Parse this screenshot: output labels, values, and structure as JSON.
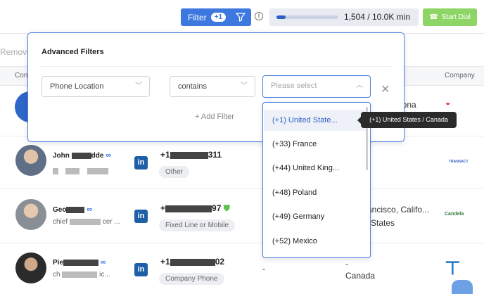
{
  "topbar": {
    "filter_label": "Filter",
    "filter_count": "+1",
    "usage_text": "1,504 / 10.0K min",
    "usage_fraction": 0.15,
    "start_dial_label": "Start Dial"
  },
  "table": {
    "remove_label": "Remove",
    "header_contact": "Con",
    "header_company": "Company",
    "rows": [
      {
        "name": "John",
        "name_suffix": "dde",
        "phone_prefix": "+1",
        "phone_suffix": "311",
        "tag": "Other"
      },
      {
        "name": "Geo",
        "title": "chief",
        "title_mid": "cer ...",
        "phone_prefix": "+",
        "phone_suffix": "97",
        "tag": "Fixed Line or Mobile",
        "location": "ancisco, Califo...",
        "location2": "States"
      },
      {
        "name": "Pie",
        "title": "ch",
        "title_mid": "ic...",
        "phone_prefix": "+1",
        "phone_suffix": "02",
        "tag": "Company Phone",
        "dash1": "-",
        "dash2": "-",
        "location": "Canada"
      }
    ],
    "row1_location": "gona"
  },
  "panel": {
    "title": "Advanced Filters",
    "field_value": "Phone Location",
    "operator_value": "contains",
    "value_placeholder": "Please select",
    "add_filter_label": "+ Add Filter"
  },
  "dropdown": {
    "options": [
      "(+1) United State...",
      "(+33) France",
      "(+44) United King...",
      "(+48) Poland",
      "(+49) Germany",
      "(+52) Mexico"
    ],
    "tooltip": "(+1) United States / Canada"
  },
  "logos": {
    "row2": "TRANSACT",
    "row3": "Candela"
  }
}
